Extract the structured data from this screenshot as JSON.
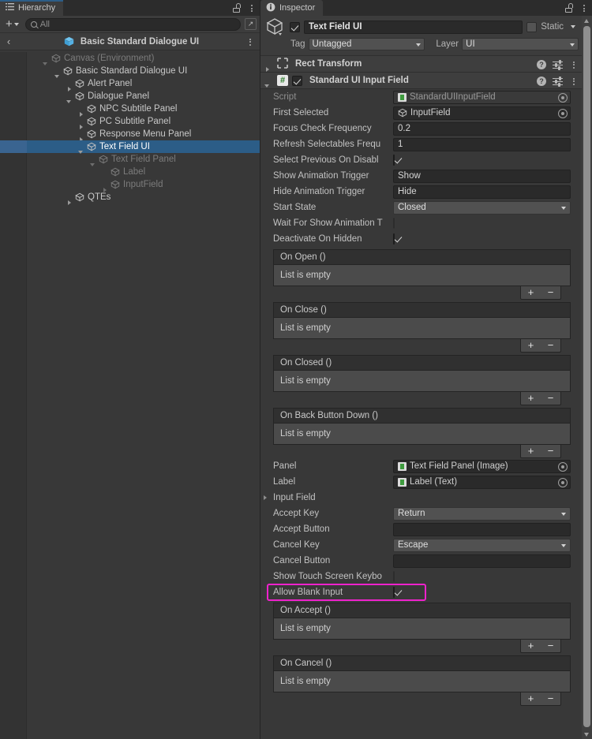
{
  "hierarchy": {
    "tab_label": "Hierarchy",
    "toolbar": {
      "add_label": "+",
      "search_placeholder": "All",
      "search_value": ""
    },
    "breadcrumb": {
      "back_label": "‹",
      "title": "Basic Standard Dialogue UI"
    },
    "tree": [
      {
        "label": "Canvas (Environment)",
        "indent": 1,
        "twisty": "open",
        "dim": true,
        "selected": false
      },
      {
        "label": "Basic Standard Dialogue UI",
        "indent": 2,
        "twisty": "open",
        "dim": false,
        "selected": false
      },
      {
        "label": "Alert Panel",
        "indent": 3,
        "twisty": "closed",
        "dim": false,
        "selected": false
      },
      {
        "label": "Dialogue Panel",
        "indent": 3,
        "twisty": "open",
        "dim": false,
        "selected": false
      },
      {
        "label": "NPC Subtitle Panel",
        "indent": 4,
        "twisty": "closed",
        "dim": false,
        "selected": false
      },
      {
        "label": "PC Subtitle Panel",
        "indent": 4,
        "twisty": "closed",
        "dim": false,
        "selected": false
      },
      {
        "label": "Response Menu Panel",
        "indent": 4,
        "twisty": "closed",
        "dim": false,
        "selected": false
      },
      {
        "label": "Text Field UI",
        "indent": 4,
        "twisty": "open",
        "dim": false,
        "selected": true
      },
      {
        "label": "Text Field Panel",
        "indent": 5,
        "twisty": "open",
        "dim": true,
        "selected": false
      },
      {
        "label": "Label",
        "indent": 6,
        "twisty": "none",
        "dim": true,
        "selected": false
      },
      {
        "label": "InputField",
        "indent": 6,
        "twisty": "closed",
        "dim": true,
        "selected": false
      },
      {
        "label": "QTEs",
        "indent": 3,
        "twisty": "closed",
        "dim": false,
        "selected": false
      }
    ]
  },
  "inspector": {
    "tab_label": "Inspector",
    "object": {
      "enabled": true,
      "name": "Text Field UI",
      "static_label": "Static",
      "static_checked": false,
      "tag_label": "Tag",
      "tag_value": "Untagged",
      "layer_label": "Layer",
      "layer_value": "UI"
    },
    "components": [
      {
        "title": "Rect Transform",
        "expanded": false,
        "has_toggle": false
      },
      {
        "title": "Standard UI Input Field",
        "expanded": true,
        "has_toggle": true,
        "toggle_checked": true
      }
    ],
    "properties": [
      {
        "label": "Script",
        "type": "object",
        "value": "StandardUIInputField",
        "icon": "script-icon",
        "disabled": true
      },
      {
        "label": "First Selected",
        "type": "object",
        "value": "InputField",
        "icon": "cube-icon",
        "disabled": false
      },
      {
        "label": "Focus Check Frequency",
        "type": "text",
        "value": "0.2"
      },
      {
        "label": "Refresh Selectables Frequ",
        "type": "text",
        "value": "1"
      },
      {
        "label": "Select Previous On Disabl",
        "type": "checkbox",
        "checked": true
      },
      {
        "label": "Show Animation Trigger",
        "type": "text",
        "value": "Show"
      },
      {
        "label": "Hide Animation Trigger",
        "type": "text",
        "value": "Hide"
      },
      {
        "label": "Start State",
        "type": "dropdown",
        "value": "Closed"
      },
      {
        "label": "Wait For Show Animation T",
        "type": "checkbox",
        "checked": false
      },
      {
        "label": "Deactivate On Hidden",
        "type": "checkbox",
        "checked": true
      }
    ],
    "events_top": [
      {
        "title": "On Open ()",
        "empty_text": "List is empty",
        "add_label": "+",
        "remove_label": "−"
      },
      {
        "title": "On Close ()",
        "empty_text": "List is empty",
        "add_label": "+",
        "remove_label": "−"
      },
      {
        "title": "On Closed ()",
        "empty_text": "List is empty",
        "add_label": "+",
        "remove_label": "−"
      },
      {
        "title": "On Back Button Down ()",
        "empty_text": "List is empty",
        "add_label": "+",
        "remove_label": "−"
      }
    ],
    "properties_mid": [
      {
        "label": "Panel",
        "type": "object",
        "value": "Text Field Panel (Image)",
        "icon": "script-icon",
        "disabled": false
      },
      {
        "label": "Label",
        "type": "object",
        "value": "Label (Text)",
        "icon": "script-icon",
        "disabled": false
      },
      {
        "label": "Input Field",
        "type": "foldout"
      },
      {
        "label": "Accept Key",
        "type": "dropdown",
        "value": "Return"
      },
      {
        "label": "Accept Button",
        "type": "empty",
        "value": ""
      },
      {
        "label": "Cancel Key",
        "type": "dropdown",
        "value": "Escape"
      },
      {
        "label": "Cancel Button",
        "type": "empty",
        "value": ""
      },
      {
        "label": "Show Touch Screen Keybo",
        "type": "checkbox",
        "checked": false
      },
      {
        "label": "Allow Blank Input",
        "type": "checkbox",
        "checked": true,
        "highlighted": true
      }
    ],
    "events_bottom": [
      {
        "title": "On Accept ()",
        "empty_text": "List is empty",
        "add_label": "+",
        "remove_label": "−"
      },
      {
        "title": "On Cancel ()",
        "empty_text": "List is empty",
        "add_label": "+",
        "remove_label": "−"
      }
    ]
  },
  "colors": {
    "accent_selection": "#2c5d87",
    "highlight_annotation": "#ee22cc",
    "panel_bg": "#383838",
    "script_green": "#3e9b3e",
    "prefab_blue": "#4fa8df"
  }
}
